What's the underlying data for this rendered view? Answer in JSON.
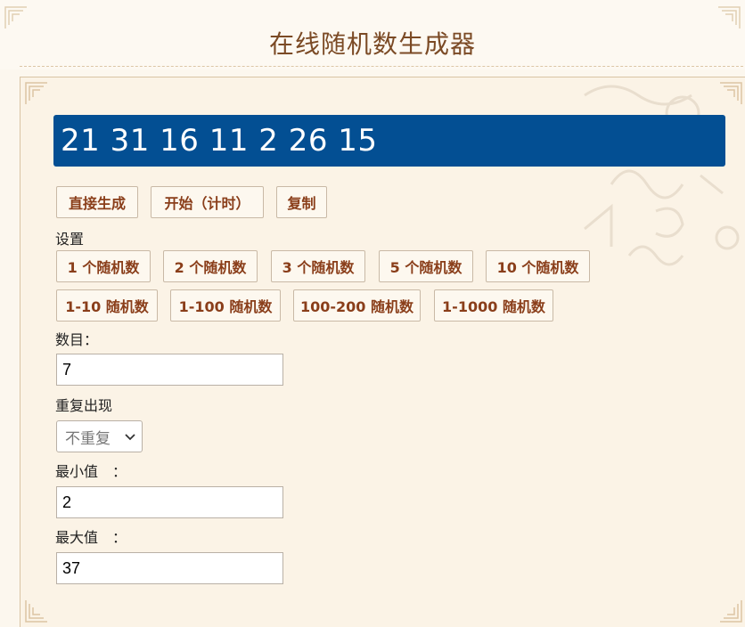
{
  "header": {
    "title": "在线随机数生成器"
  },
  "result": {
    "numbers": "21 31 16 11 2 26 15"
  },
  "actions": {
    "generate": "直接生成",
    "start_timed": "开始（计时）",
    "copy": "复制"
  },
  "settings": {
    "label": "设置",
    "presets_row1": [
      "1 个随机数",
      "2 个随机数",
      "3 个随机数",
      "5 个随机数",
      "10 个随机数"
    ],
    "presets_row2": [
      "1-10 随机数",
      "1-100 随机数",
      "100-200 随机数",
      "1-1000 随机数"
    ]
  },
  "form": {
    "count_label": "数目：",
    "count_value": "7",
    "repeat_label": "重复出现",
    "repeat_selected": "不重复",
    "min_label": "最小值　：",
    "min_value": "2",
    "max_label": "最大值　：",
    "max_value": "37"
  },
  "colors": {
    "result_bg": "#034f93",
    "button_text": "#8a3e1a",
    "title": "#7b4a25"
  }
}
